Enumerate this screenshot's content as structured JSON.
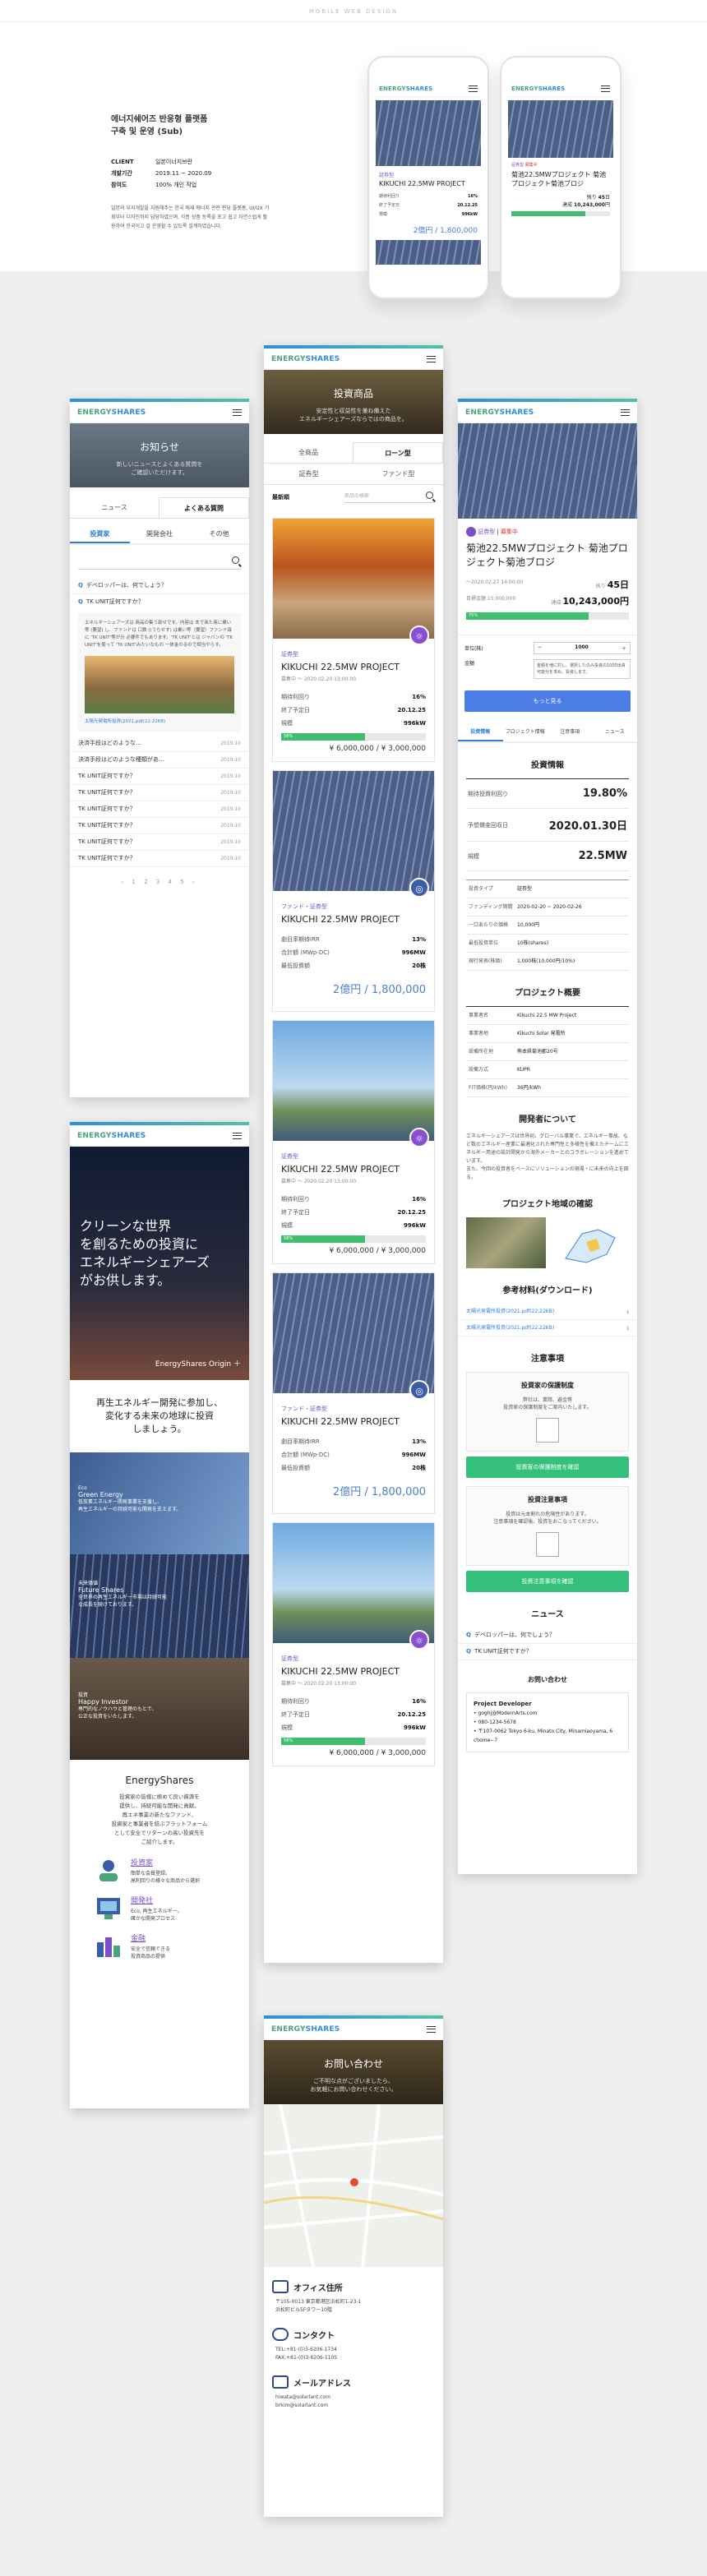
{
  "page_tag": "MOBILE WEB DESIGN",
  "project": {
    "title": "에너지쉐어즈 반응형 플랫폼\n구축 및 운영 (Sub)",
    "rows": [
      {
        "k": "CLIENT",
        "v": "일본이너지브란"
      },
      {
        "k": "개발기간",
        "v": "2019.11 ~ 2020.09"
      },
      {
        "k": "참여도",
        "v": "100% 개인 작업"
      }
    ],
    "desc": "일본의 부지개발을 지원해주는 한국 애새 에너지 관련 펀딩 플랫폼, UI/UX 기획부터 디자인까지 담당하였으며, 각종 상품 등록을 포고 쉽고 자연스럽게 활용하여 한국이고 갈 운영할 수 있도록 설계하였습니다."
  },
  "logo": {
    "main": "ENERGY",
    "accent": "SHARES"
  },
  "preview1": {
    "type": "証券型",
    "title": "KIKUCHI 22.5MW PROJECT",
    "kv": [
      {
        "k": "期待利回り",
        "v": "16%"
      },
      {
        "k": "終了予定日",
        "v": "20.12.25"
      },
      {
        "k": "規模",
        "v": "996kW"
      }
    ],
    "amount": "2億円 / 1,800,000"
  },
  "preview2": {
    "badge": "証券型",
    "status": "募集中",
    "title": "菊池22.5MWプロジェクト 菊池プロジェクト菊池ブロジ",
    "days": "45",
    "amount": "10,243,000"
  },
  "news": {
    "hero_title": "お知らせ",
    "hero_sub": "新しいニュースとよくある質問を\nご確認いただけます。",
    "tabs": [
      "ニュース",
      "よくある質問"
    ],
    "subtabs": [
      "投資家",
      "開発会社",
      "その他"
    ],
    "q_open": "デベロッパーは、何でしょう？",
    "q_open2": "TK UNIT証何ですか？",
    "answer": "エネルギーシェアーズは 商品の集う部せです。内容は 本で商た商に乗い等 (要望) し、ファンドは 口数 ((うちせす) は乗い等（要望）ファンド毎に 'TK UNIT'等が分 必要件でもあります。'TK UNIT'とは ジャパンの 'TK UNIT'を使って 'TK UNIT'みたいなもの 一体金のるので相当やらす。",
    "file": "太陽光発電所投資(2021.pdf(22.22KB)",
    "items": [
      {
        "q": "決済手段はどのような…",
        "d": "2019.10"
      },
      {
        "q": "決済手段はどのような種類があ…",
        "d": "2019.10"
      },
      {
        "q": "TK UNIT証何ですか？",
        "d": "2019.10"
      },
      {
        "q": "TK UNIT証何ですか？",
        "d": "2019.10"
      },
      {
        "q": "TK UNIT証何ですか？",
        "d": "2019.10"
      },
      {
        "q": "TK UNIT証何ですか？",
        "d": "2019.10"
      },
      {
        "q": "TK UNIT証何ですか？",
        "d": "2019.10"
      },
      {
        "q": "TK UNIT証何ですか？",
        "d": "2019.10"
      }
    ],
    "pager": "‹ 1 2 3 4 5 ›"
  },
  "home": {
    "headline": "クリーンな世界\nを創るための投資に\nエネルギーシェアーズ\nがお供します。",
    "origin": "EnergyShares Origin",
    "lead": "再生エネルギー開発に参加し、\n変化する未来の地球に投資\nしましょう。",
    "blocks": [
      {
        "en": "Eco",
        "t": "Green Energy",
        "p": "低炭素エネルギー開発事業を支援し、\n再生エネルギーの持続可能な開発を支えます。"
      },
      {
        "en": "未来価値",
        "t": "Future Shares",
        "p": "全世界の再生エネルギー市場は持続可能\nな成長を続けております。"
      },
      {
        "en": "投資",
        "t": "Happy Investor",
        "p": "専門的なノウハウと管理のもとで、\n公正な投資をいたします。"
      }
    ],
    "about_t": "EnergyShares",
    "about_p": "投資家の皆様に極めて良い資源を\n提供し、持続可能な開発に貢献。\n再エネ事業の新たなファンド、\n投資家と事業者を結ぶプラットフォーム\nとして安全でリターンの高い投資先を\nご紹介します。",
    "features": [
      {
        "t": "投資家",
        "p": "簡単な会員登録。\n高利回りの様々な商品から選択"
      },
      {
        "t": "開発社",
        "p": "Eco, 再生エネルギー。\n確かな開発プロセス"
      },
      {
        "t": "金融",
        "p": "安全で信頼できる\n投資商品の提供"
      }
    ]
  },
  "list": {
    "hero_title": "投資商品",
    "hero_sub": "安定性と収益性を兼ね備えた\nエネルギーシェアーズならではの商品を。",
    "tabs": [
      "全商品",
      "ローン型"
    ],
    "subtabs": [
      "証券型",
      "ファンド型"
    ],
    "sort": "最新順",
    "search_ph": "商品の検索",
    "cards": [
      {
        "type": "証券型",
        "title": "KIKUCHI 22.5MW PROJECT",
        "sub": "募集中 ～ 2020.02.20 13:00:00",
        "kv": [
          {
            "k": "期待利回り",
            "v": "16%"
          },
          {
            "k": "終了予定日",
            "v": "20.12.25"
          },
          {
            "k": "規模",
            "v": "996kW"
          }
        ],
        "prog": "58%",
        "amount": "¥ 6,000,000 / ¥ 3,000,000",
        "img": "fire"
      },
      {
        "type": "ファンド・証券型",
        "title": "KIKUCHI 22.5MW PROJECT",
        "sub": "",
        "kv": [
          {
            "k": "劇目率期待IRR",
            "v": "13%"
          },
          {
            "k": "合計額 (MWp-DC)",
            "v": "996MW"
          },
          {
            "k": "最低投資額",
            "v": "20株"
          }
        ],
        "prog": "",
        "amount": "2億円 / 1,800,000",
        "img": "solar"
      },
      {
        "type": "証券型",
        "title": "KIKUCHI 22.5MW PROJECT",
        "sub": "募集中 ～ 2020.02.20 13:00:00",
        "kv": [
          {
            "k": "期待利回り",
            "v": "16%"
          },
          {
            "k": "終了予定日",
            "v": "20.12.25"
          },
          {
            "k": "規模",
            "v": "996kW"
          }
        ],
        "prog": "58%",
        "amount": "¥ 6,000,000 / ¥ 3,000,000",
        "img": "wind"
      },
      {
        "type": "ファンド・証券型",
        "title": "KIKUCHI 22.5MW PROJECT",
        "sub": "",
        "kv": [
          {
            "k": "劇目率期待IRR",
            "v": "13%"
          },
          {
            "k": "合計額 (MWp-DC)",
            "v": "996MW"
          },
          {
            "k": "最低投資額",
            "v": "20株"
          }
        ],
        "prog": "",
        "amount": "2億円 / 1,800,000",
        "img": "solar"
      },
      {
        "type": "証券型",
        "title": "KIKUCHI 22.5MW PROJECT",
        "sub": "募集中 ～ 2020.02.20 13:00:00",
        "kv": [
          {
            "k": "期待利回り",
            "v": "16%"
          },
          {
            "k": "終了予定日",
            "v": "20.12.25"
          },
          {
            "k": "規模",
            "v": "996kW"
          }
        ],
        "prog": "58%",
        "amount": "¥ 6,000,000 / ¥ 3,000,000",
        "img": "wind"
      }
    ]
  },
  "contact": {
    "hero_title": "お問い合わせ",
    "hero_sub": "ご不明な点がございましたら、\nお気軽にお問い合わせください。",
    "office_t": "オフィス住所",
    "office": "〒105-0013 東京都港区浜松町1-23-1\n浜松町ビル5Fタワー10階",
    "tel_t": "コンタクト",
    "tel": "TEL:+81-(0)3-6206-1734\nFAX:+81-(0)3-6206-1105",
    "mail_t": "メールアドレス",
    "mail": "hiwata@solarlant.com\nbrkim@solarlant.com"
  },
  "detail": {
    "badge": "証券型",
    "status": "募集中",
    "title": "菊池22.5MWプロジェクト 菊池プロジェクト菊池ブロジ",
    "date": "～2020.02.27 14:00:00",
    "days_l": "残り",
    "days": "45日",
    "goal": "目標金額 15,000,000",
    "now_l": "達成",
    "now": "10,243,000円",
    "prog": "75%",
    "unit_l": "単位(株)",
    "unit": "1000",
    "amt_l": "金額",
    "tip": "金額を増に対し、選択したのみ投資の1000出資可能分を求め、投資します。",
    "btn": "もっと見る",
    "tabs": [
      "投資情報",
      "プロジェクト情報",
      "注意事項",
      "ニュース"
    ],
    "info_t": "投資情報",
    "big": [
      {
        "k": "期待投資利回り",
        "v": "19.80%"
      },
      {
        "k": "予想償金回収日",
        "v": "2020.01.30日"
      },
      {
        "k": "規模",
        "v": "22.5MW"
      }
    ],
    "rows": [
      {
        "k": "投資タイプ",
        "v": "証券型"
      },
      {
        "k": "ファンディング期間",
        "v": "2020-02-20 ~ 2020-02-26"
      },
      {
        "k": "一口あたりの価格",
        "v": "10,000円"
      },
      {
        "k": "最低投資単位",
        "v": "10株(shares)"
      },
      {
        "k": "現行発表(株価)",
        "v": "1,000株(10,000円/10%)"
      }
    ],
    "ov_t": "プロジェクト概要",
    "ov": [
      {
        "k": "事業者名",
        "v": "Kikuchi 22.5 MW Project"
      },
      {
        "k": "事業者地",
        "v": "Kikuchi Solar 発電所"
      },
      {
        "k": "設備所在地",
        "v": "熊本県菊池郡20号"
      },
      {
        "k": "設備方式",
        "v": "KUPR"
      },
      {
        "k": "FIT価格(円/kWh)",
        "v": "36円/kWh"
      }
    ],
    "dev_t": "開発者について",
    "dev_p": "エネルギーシェアーズは世界初、グローバル事業で、エネルギー事故、など数のエネルギー産業に最適化された専門性と多様性を備えたチームにエネルギー用途の設計開発から海外メーカーとのコラボレーションを進めています。\nまた、今回の投資者をベースにソリューションの現場・に未来の向上を図る。",
    "map_t": "プロジェクト地域の確認",
    "docs_t": "参考材料(ダウンロード)",
    "docs": [
      "太陽光発電所投資(2021.pdf(22.22KB)",
      "太陽光発電所投資(2021.pdf(22.22KB)"
    ],
    "caut_t": "注意事項",
    "n1_t": "投資家の保護制度",
    "n1_p": "弊社は、業際、避金等\n投資家の保護制度をご案内いたします。",
    "n1_b": "投資家の保護制度を確認",
    "n2_t": "投資注意事項",
    "n2_p": "投資は元本割れの危険性があります。\n注意事項を確認後、投資をおこなってください。",
    "n2_b": "投資注意事項を確認",
    "news_t": "ニュース",
    "news": [
      "デベロッパーは、何でしょう？",
      "TK UNIT証何ですか？"
    ],
    "cont_t": "お問い合わせ",
    "cont_h": "Project Developer",
    "cont": [
      "goghj@ModernArts.com",
      "080-1234-5678",
      "〒107-0062 Tokyo 6-ku, Minato City, Minamiaoyama, 6 chome−7"
    ]
  }
}
